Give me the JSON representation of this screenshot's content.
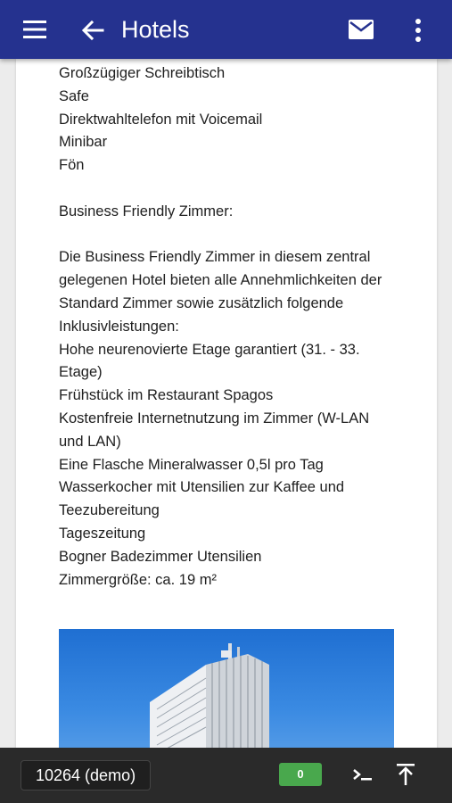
{
  "appbar": {
    "title": "Hotels",
    "icons": [
      "menu-icon",
      "back-arrow-icon",
      "mail-icon",
      "more-vertical-icon"
    ]
  },
  "content": {
    "lines_top": [
      "Großzügiger Schreibtisch",
      "Safe",
      "Direktwahltelefon mit Voicemail",
      "Minibar",
      "Fön"
    ],
    "section_title": "Business Friendly Zimmer:",
    "paragraph": "Die Business Friendly Zimmer in diesem zentral gelegenen Hotel bieten alle Annehmlichkeiten der Standard Zimmer sowie zusätzlich folgende Inklusivleistungen:",
    "features": [
      "Hohe neurenovierte Etage garantiert (31. - 33. Etage)",
      "Frühstück im Restaurant Spagos",
      "Kostenfreie Internetnutzung im Zimmer (W-LAN und LAN)",
      "Eine Flasche Mineralwasser 0,5l pro Tag",
      "Wasserkocher mit Utensilien zur Kaffee und Teezubereitung",
      "Tageszeitung",
      "Bogner Badezimmer Utensilien",
      "Zimmergröße: ca. 19 m²"
    ]
  },
  "bottombar": {
    "account": "10264 (demo)",
    "count": "0",
    "icons": [
      "terminal-icon",
      "scroll-to-top-icon"
    ]
  },
  "colors": {
    "appbar": "#25328f",
    "bottombar": "#2a2a2a",
    "badge": "#49a84d"
  }
}
